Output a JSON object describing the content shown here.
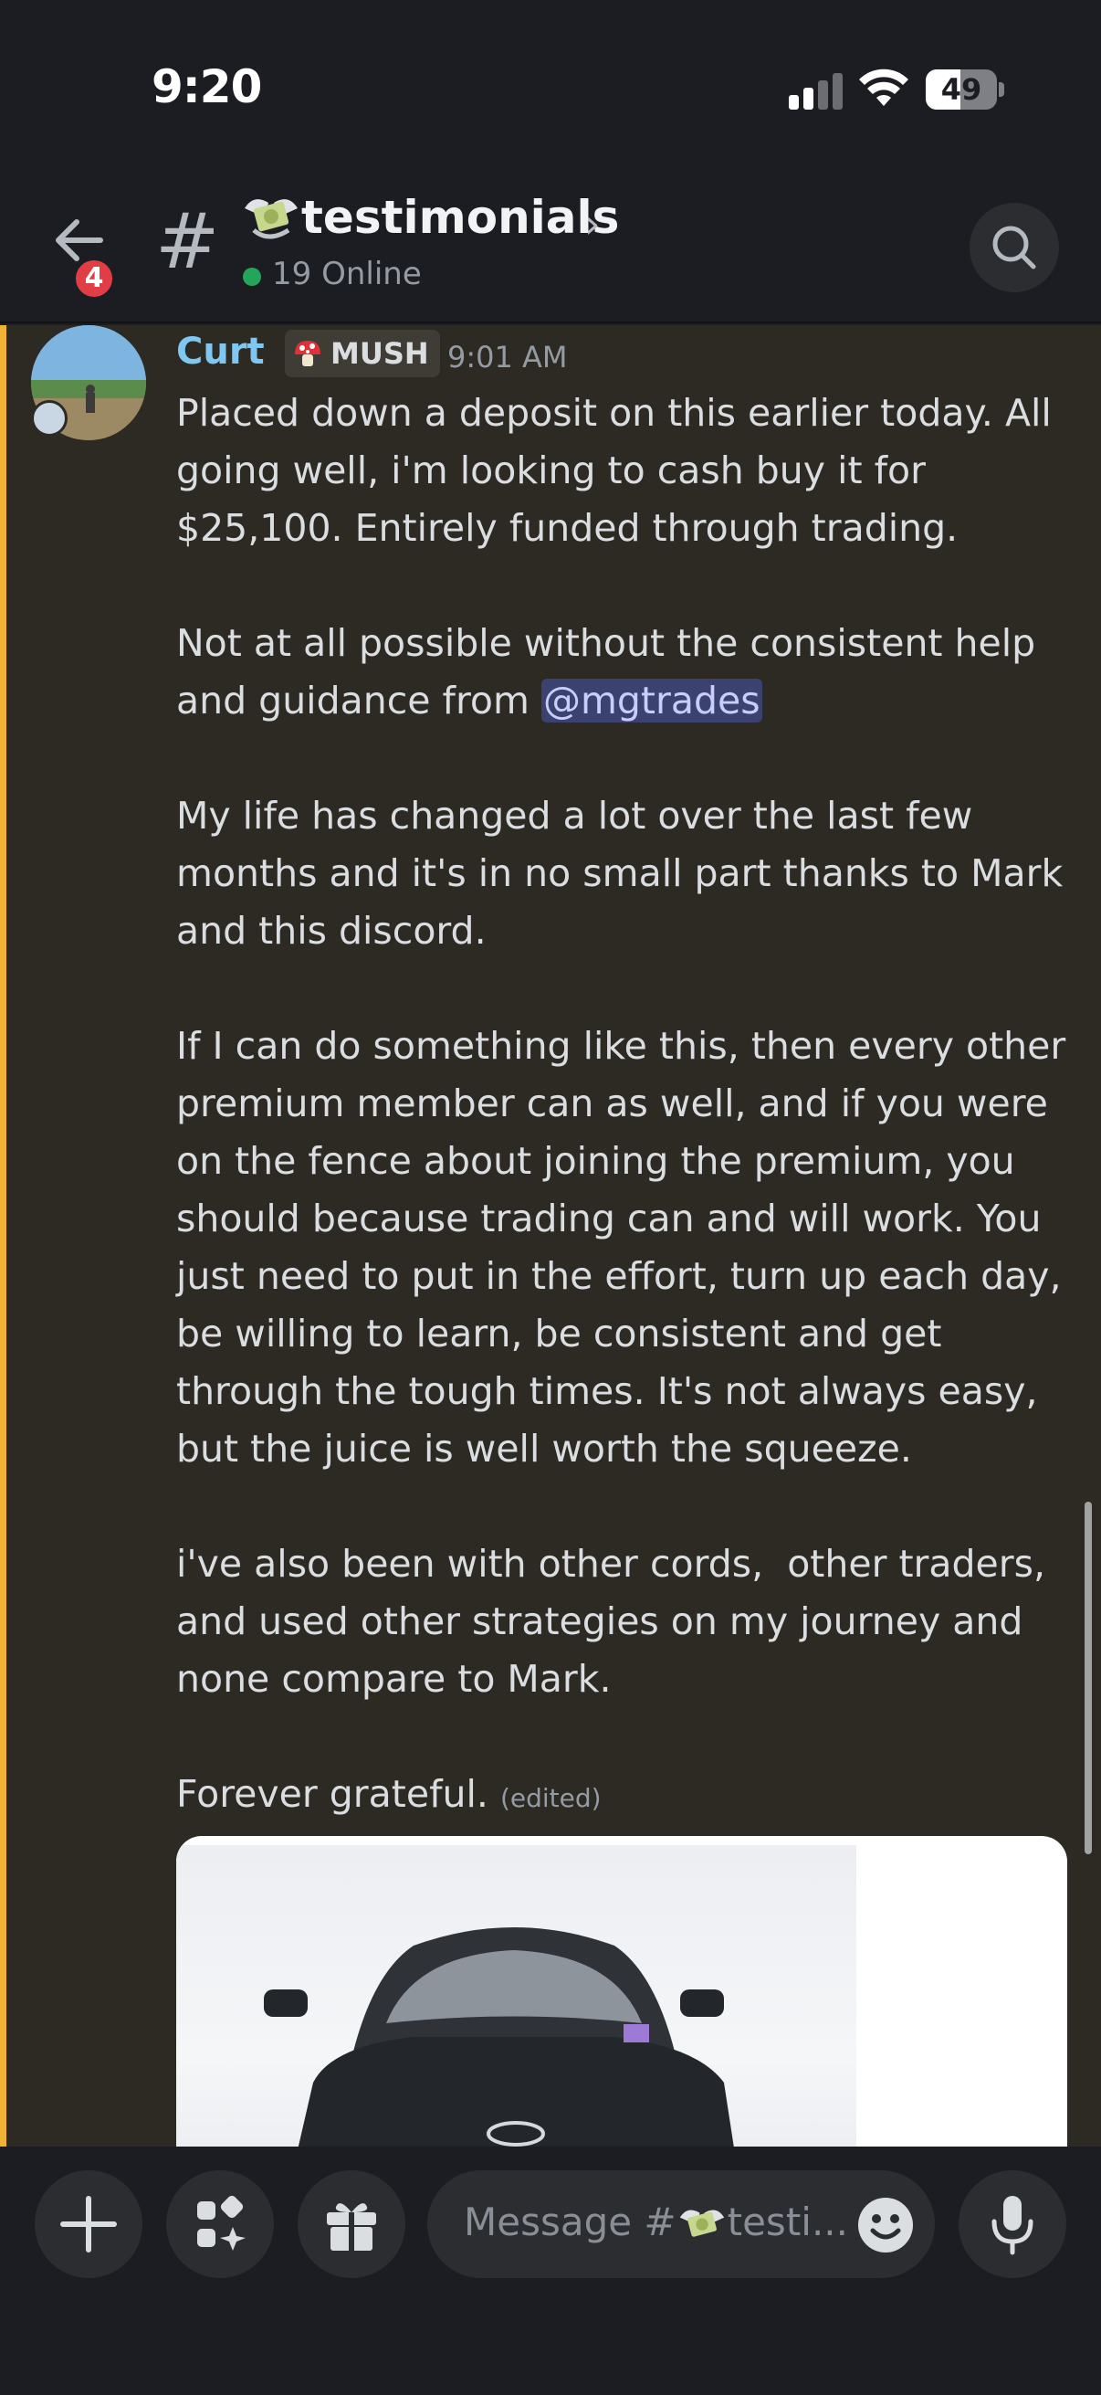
{
  "status_bar": {
    "time": "9:20",
    "battery": "49"
  },
  "header": {
    "back_badge": "4",
    "channel_name": "testimonials",
    "online": "19 Online"
  },
  "message": {
    "author": "Curt",
    "role": "MUSH",
    "time": "9:01 AM",
    "paragraphs": [
      "Placed down a deposit on this earlier today. All going well, i'm looking to cash buy it for $25,100. Entirely funded through trading.",
      "My life has changed a lot over the last few months and it's in no small part thanks to Mark and this discord.",
      "If I can do something like this, then every other premium member can as well, and if you were on the fence about joining the premium, you should because trading can and will work. You just need to put in the effort, turn up each day, be willing to learn, be consistent and get through the tough times. It's not always easy, but the juice is well worth the squeeze.",
      "i've also been with other cords,  other traders, and used other strategies on my journey and none compare to Mark."
    ],
    "para2_prefix": "Not at all possible without the consistent help and guidance from ",
    "mention": "@mgtrades",
    "final_line": "Forever grateful.",
    "edited": "(edited)"
  },
  "composer": {
    "placeholder_prefix": "Message #",
    "placeholder_suffix": "testi..."
  },
  "colors": {
    "accent_highlight": "#f0b232",
    "author_color": "#7fc6f0",
    "mention_bg": "#3c4270",
    "online": "#23a55a",
    "badge": "#e13d45"
  }
}
